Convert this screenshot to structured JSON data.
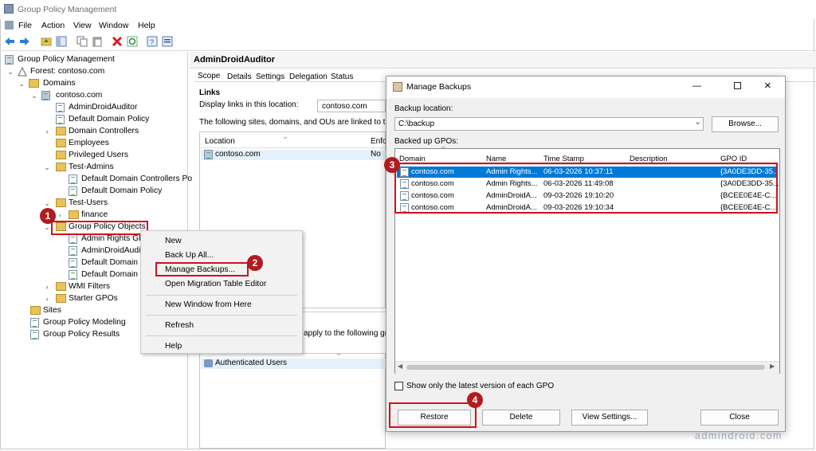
{
  "window": {
    "title": "Group Policy Management"
  },
  "menu": [
    "File",
    "Action",
    "View",
    "Window",
    "Help"
  ],
  "tree": {
    "root": "Group Policy Management",
    "forest": "Forest: contoso.com",
    "domains": "Domains",
    "domain": "contoso.com",
    "items": {
      "admindroid_auditor": "AdminDroidAuditor",
      "default_domain_policy": "Default Domain Policy",
      "domain_controllers": "Domain Controllers",
      "employees": "Employees",
      "privileged_users": "Privileged Users",
      "test_admins": "Test-Admins",
      "ta_default_dc": "Default Domain Controllers Po",
      "ta_default_dp": "Default Domain Policy",
      "test_users": "Test-Users",
      "finance": "finance",
      "gpo": "Group Policy Objects",
      "gpo_admin_rights": "Admin Rights GP",
      "gpo_admindroid": "AdminDroidAudi",
      "gpo_default1": "Default Domain (",
      "gpo_default2": "Default Domain I",
      "wmi": "WMI Filters",
      "starter": "Starter GPOs"
    },
    "sites": "Sites",
    "modeling": "Group Policy Modeling",
    "results": "Group Policy Results"
  },
  "context_menu": {
    "new": "New",
    "backup_all": "Back Up All...",
    "manage_backups": "Manage Backups...",
    "migration": "Open Migration Table Editor",
    "new_window": "New Window from Here",
    "refresh": "Refresh",
    "help": "Help"
  },
  "details": {
    "heading": "AdminDroidAuditor",
    "tabs": [
      "Scope",
      "Details",
      "Settings",
      "Delegation",
      "Status"
    ],
    "links_label": "Links",
    "display_links_label": "Display links in this location:",
    "display_links_value": "contoso.com",
    "linked_text": "The following sites, domains, and OUs are linked to this GPO",
    "col_location": "Location",
    "col_enforced": "Enfor",
    "row_location": "contoso.com",
    "row_enforced": "No",
    "filter_text": "apply to the following grou",
    "auth_users": "Authenticated Users"
  },
  "dialog": {
    "title": "Manage Backups",
    "backup_location_label": "Backup location:",
    "backup_location_value": "C:\\backup",
    "browse": "Browse...",
    "backed_up_label": "Backed up GPOs:",
    "columns": [
      "Domain",
      "Name",
      "Time Stamp",
      "Description",
      "GPO ID"
    ],
    "rows": [
      {
        "domain": "contoso.com",
        "name": "Admin Rights...",
        "time": "06-03-2026 10:37:11",
        "desc": "",
        "id": "{3A0DE3DD-35..."
      },
      {
        "domain": "contoso.com",
        "name": "Admin Rights...",
        "time": "06-03-2026 11:49:08",
        "desc": "",
        "id": "{3A0DE3DD-35..."
      },
      {
        "domain": "contoso.com",
        "name": "AdminDroidA...",
        "time": "09-03-2026 19:10:20",
        "desc": "",
        "id": "{BCEE0E4E-C..."
      },
      {
        "domain": "contoso.com",
        "name": "AdminDroidA...",
        "time": "09-03-2026 19:10:34",
        "desc": "",
        "id": "{BCEE0E4E-C..."
      }
    ],
    "latest_only": "Show only the latest version of each GPO",
    "restore": "Restore",
    "delete": "Delete",
    "view_settings": "View Settings...",
    "close": "Close"
  },
  "badges": [
    "1",
    "2",
    "3",
    "4"
  ],
  "watermark": "admindroid.com",
  "colors": {
    "highlight_red": "#d0101e",
    "badge": "#b01c1f",
    "selection": "#0078d7",
    "folder": "#e8c25a"
  }
}
